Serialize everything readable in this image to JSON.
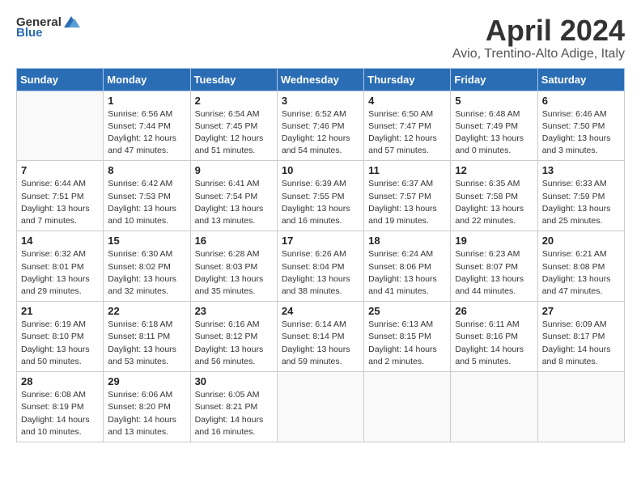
{
  "header": {
    "logo_general": "General",
    "logo_blue": "Blue",
    "title": "April 2024",
    "subtitle": "Avio, Trentino-Alto Adige, Italy"
  },
  "weekdays": [
    "Sunday",
    "Monday",
    "Tuesday",
    "Wednesday",
    "Thursday",
    "Friday",
    "Saturday"
  ],
  "weeks": [
    [
      {
        "day": "",
        "info": ""
      },
      {
        "day": "1",
        "info": "Sunrise: 6:56 AM\nSunset: 7:44 PM\nDaylight: 12 hours\nand 47 minutes."
      },
      {
        "day": "2",
        "info": "Sunrise: 6:54 AM\nSunset: 7:45 PM\nDaylight: 12 hours\nand 51 minutes."
      },
      {
        "day": "3",
        "info": "Sunrise: 6:52 AM\nSunset: 7:46 PM\nDaylight: 12 hours\nand 54 minutes."
      },
      {
        "day": "4",
        "info": "Sunrise: 6:50 AM\nSunset: 7:47 PM\nDaylight: 12 hours\nand 57 minutes."
      },
      {
        "day": "5",
        "info": "Sunrise: 6:48 AM\nSunset: 7:49 PM\nDaylight: 13 hours\nand 0 minutes."
      },
      {
        "day": "6",
        "info": "Sunrise: 6:46 AM\nSunset: 7:50 PM\nDaylight: 13 hours\nand 3 minutes."
      }
    ],
    [
      {
        "day": "7",
        "info": "Sunrise: 6:44 AM\nSunset: 7:51 PM\nDaylight: 13 hours\nand 7 minutes."
      },
      {
        "day": "8",
        "info": "Sunrise: 6:42 AM\nSunset: 7:53 PM\nDaylight: 13 hours\nand 10 minutes."
      },
      {
        "day": "9",
        "info": "Sunrise: 6:41 AM\nSunset: 7:54 PM\nDaylight: 13 hours\nand 13 minutes."
      },
      {
        "day": "10",
        "info": "Sunrise: 6:39 AM\nSunset: 7:55 PM\nDaylight: 13 hours\nand 16 minutes."
      },
      {
        "day": "11",
        "info": "Sunrise: 6:37 AM\nSunset: 7:57 PM\nDaylight: 13 hours\nand 19 minutes."
      },
      {
        "day": "12",
        "info": "Sunrise: 6:35 AM\nSunset: 7:58 PM\nDaylight: 13 hours\nand 22 minutes."
      },
      {
        "day": "13",
        "info": "Sunrise: 6:33 AM\nSunset: 7:59 PM\nDaylight: 13 hours\nand 25 minutes."
      }
    ],
    [
      {
        "day": "14",
        "info": "Sunrise: 6:32 AM\nSunset: 8:01 PM\nDaylight: 13 hours\nand 29 minutes."
      },
      {
        "day": "15",
        "info": "Sunrise: 6:30 AM\nSunset: 8:02 PM\nDaylight: 13 hours\nand 32 minutes."
      },
      {
        "day": "16",
        "info": "Sunrise: 6:28 AM\nSunset: 8:03 PM\nDaylight: 13 hours\nand 35 minutes."
      },
      {
        "day": "17",
        "info": "Sunrise: 6:26 AM\nSunset: 8:04 PM\nDaylight: 13 hours\nand 38 minutes."
      },
      {
        "day": "18",
        "info": "Sunrise: 6:24 AM\nSunset: 8:06 PM\nDaylight: 13 hours\nand 41 minutes."
      },
      {
        "day": "19",
        "info": "Sunrise: 6:23 AM\nSunset: 8:07 PM\nDaylight: 13 hours\nand 44 minutes."
      },
      {
        "day": "20",
        "info": "Sunrise: 6:21 AM\nSunset: 8:08 PM\nDaylight: 13 hours\nand 47 minutes."
      }
    ],
    [
      {
        "day": "21",
        "info": "Sunrise: 6:19 AM\nSunset: 8:10 PM\nDaylight: 13 hours\nand 50 minutes."
      },
      {
        "day": "22",
        "info": "Sunrise: 6:18 AM\nSunset: 8:11 PM\nDaylight: 13 hours\nand 53 minutes."
      },
      {
        "day": "23",
        "info": "Sunrise: 6:16 AM\nSunset: 8:12 PM\nDaylight: 13 hours\nand 56 minutes."
      },
      {
        "day": "24",
        "info": "Sunrise: 6:14 AM\nSunset: 8:14 PM\nDaylight: 13 hours\nand 59 minutes."
      },
      {
        "day": "25",
        "info": "Sunrise: 6:13 AM\nSunset: 8:15 PM\nDaylight: 14 hours\nand 2 minutes."
      },
      {
        "day": "26",
        "info": "Sunrise: 6:11 AM\nSunset: 8:16 PM\nDaylight: 14 hours\nand 5 minutes."
      },
      {
        "day": "27",
        "info": "Sunrise: 6:09 AM\nSunset: 8:17 PM\nDaylight: 14 hours\nand 8 minutes."
      }
    ],
    [
      {
        "day": "28",
        "info": "Sunrise: 6:08 AM\nSunset: 8:19 PM\nDaylight: 14 hours\nand 10 minutes."
      },
      {
        "day": "29",
        "info": "Sunrise: 6:06 AM\nSunset: 8:20 PM\nDaylight: 14 hours\nand 13 minutes."
      },
      {
        "day": "30",
        "info": "Sunrise: 6:05 AM\nSunset: 8:21 PM\nDaylight: 14 hours\nand 16 minutes."
      },
      {
        "day": "",
        "info": ""
      },
      {
        "day": "",
        "info": ""
      },
      {
        "day": "",
        "info": ""
      },
      {
        "day": "",
        "info": ""
      }
    ]
  ]
}
